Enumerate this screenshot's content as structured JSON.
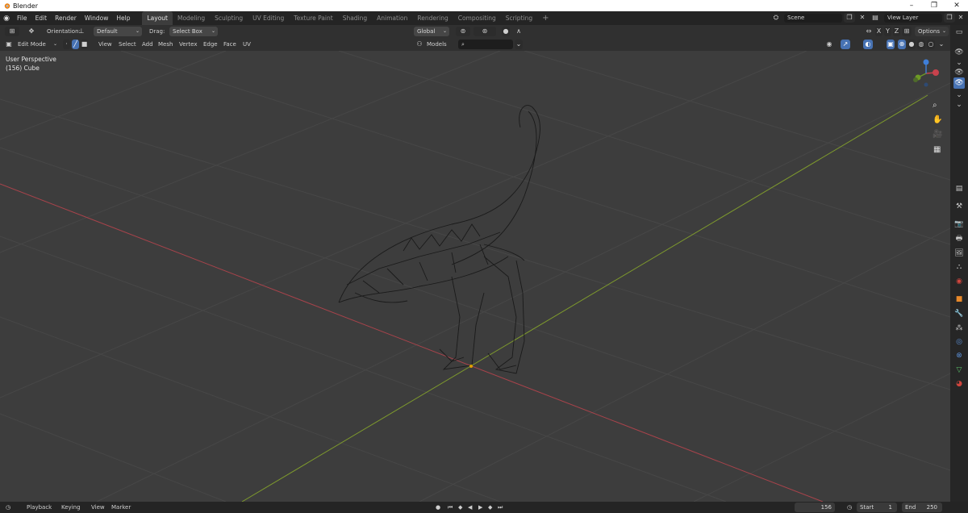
{
  "window": {
    "title": "Blender"
  },
  "menu": [
    "File",
    "Edit",
    "Render",
    "Window",
    "Help"
  ],
  "workspace_tabs": [
    "Layout",
    "Modeling",
    "Sculpting",
    "UV Editing",
    "Texture Paint",
    "Shading",
    "Animation",
    "Rendering",
    "Compositing",
    "Scripting"
  ],
  "scene": {
    "name": "Scene",
    "view_layer": "View Layer"
  },
  "tool_header": {
    "orientation_label": "Orientation:",
    "orientation_value": "Default",
    "drag_label": "Drag:",
    "drag_value": "Select Box",
    "transform_orientation": "Global",
    "options_label": "Options"
  },
  "header": {
    "mode": "Edit Mode",
    "menus": [
      "View",
      "Select",
      "Add",
      "Mesh",
      "Vertex",
      "Edge",
      "Face",
      "UV"
    ],
    "collection": "Models"
  },
  "viewport": {
    "perspective_label": "User Perspective",
    "object_label": "(156) Cube"
  },
  "gizmo": {
    "axes": [
      "X",
      "Y",
      "Z"
    ]
  },
  "timeline": {
    "menus": [
      "Playback",
      "Keying",
      "View",
      "Marker"
    ],
    "current_frame": "156",
    "start_label": "Start",
    "start_value": "1",
    "end_label": "End",
    "end_value": "250"
  },
  "colors": {
    "accent": "#4772b3",
    "x_axis": "#a8434b",
    "y_axis": "#7e9a2d",
    "background": "#3d3d3d"
  }
}
